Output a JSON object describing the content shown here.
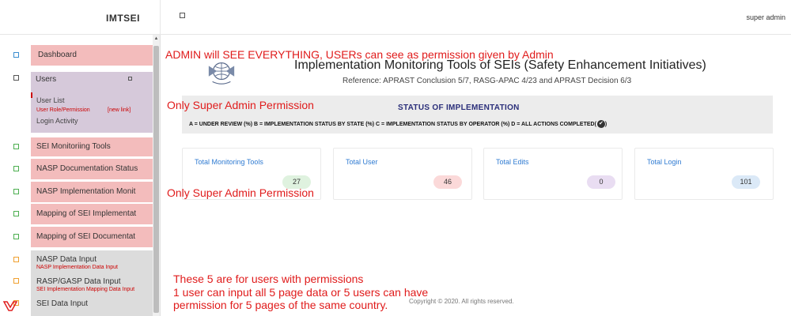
{
  "brand": "IMTSEI",
  "topbar": {
    "user": "super admin"
  },
  "sidebar": {
    "dashboard": "Dashboard",
    "users": "Users",
    "users_sub": [
      "User List",
      "User Role/Permission",
      "[new link]",
      "Login Activity"
    ],
    "items": [
      "SEI Monitoriing Tools",
      "NASP Documentation Status",
      "NASP Implementation Monit",
      "Mapping of SEI Implementat",
      "Mapping of SEI Documentat"
    ],
    "data_inputs": [
      {
        "label": "NASP Data Input",
        "note": "NASP Implementation Data Input"
      },
      {
        "label": "RASP/GASP Data Input",
        "note": "SEI Implementation Mapping Data Input"
      },
      {
        "label": "SEI Data Input",
        "note": ""
      }
    ]
  },
  "header": {
    "title": "Implementation Monitoring Tools of SEIs (Safety Enhancement Initiatives)",
    "reference": "Reference: APRAST Conclusion 5/7, RASG-APAC 4/23 and APRAST Decision 6/3"
  },
  "status": {
    "title": "STATUS OF IMPLEMENTATION",
    "legend": "A = UNDER REVIEW (%)   B = IMPLEMENTATION STATUS BY STATE (%)   C = IMPLEMENTATION STATUS BY OPERATOR (%)   D = ALL ACTIONS COMPLETED("
  },
  "cards": [
    {
      "title": "Total Monitoring Tools",
      "value": "27",
      "color": "#dff2df"
    },
    {
      "title": "Total User",
      "value": "46",
      "color": "#fbd9d9"
    },
    {
      "title": "Total Edits",
      "value": "0",
      "color": "#e9ddf2"
    },
    {
      "title": "Total Login",
      "value": "101",
      "color": "#dbe9f7"
    }
  ],
  "footer": "Copyright © 2020. All rights reserved.",
  "annotations": {
    "admin_note": "ADMIN will SEE EVERYTHING,  USERs can see as permission given by Admin",
    "super_admin_1": "Only Super Admin Permission",
    "super_admin_2": "Only Super Admin Permission",
    "users_note": [
      "These 5 are for users with permissions",
      "1 user can input all 5 page data or 5 users can have",
      "permission for 5 pages of the same country."
    ]
  }
}
